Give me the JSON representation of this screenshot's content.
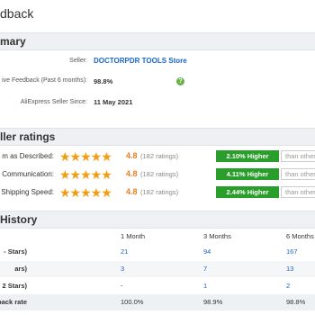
{
  "page": {
    "title": "dback"
  },
  "summary": {
    "header": "mary",
    "seller_label": "Seller:",
    "seller_name": "DOCTORPDR TOOLS Store",
    "feedback_label": "ive Feedback (Past 6 months):",
    "feedback_value": "98.8%",
    "since_label": "AliExpress Seller Since:",
    "since_value": "11 May 2021"
  },
  "ratings": {
    "header": "ller ratings",
    "rows": [
      {
        "label": "m as Described:",
        "stars": "★★★★★",
        "score": "4.8",
        "count": "(182 ratings)",
        "compare": "2.10% Higher",
        "compare_text": "than other"
      },
      {
        "label": "Communication:",
        "stars": "★★★★★",
        "score": "4.8",
        "count": "(182 ratings)",
        "compare": "4.11% Higher",
        "compare_text": "than other"
      },
      {
        "label": "Shipping Speed:",
        "stars": "★★★★★",
        "score": "4.8",
        "count": "(182 ratings)",
        "compare": "2.44% Higher",
        "compare_text": "than other"
      }
    ],
    "colors": {
      "stars": "#f39c12",
      "score": "#e67e22",
      "higher": "#2a9e2a"
    }
  },
  "history": {
    "header": "History",
    "columns": [
      "1 Month",
      "3 Months",
      "6 Months"
    ],
    "rows": [
      {
        "label": "- Stars)",
        "values": [
          "21",
          "94",
          "167"
        ]
      },
      {
        "label": "ars)",
        "values": [
          "3",
          "7",
          "13"
        ]
      },
      {
        "label": "2 Stars)",
        "values": [
          "-",
          "1",
          "2"
        ]
      },
      {
        "label": "dback rate",
        "values": [
          "100.0%",
          "98.9%",
          "98.8%"
        ]
      }
    ]
  }
}
